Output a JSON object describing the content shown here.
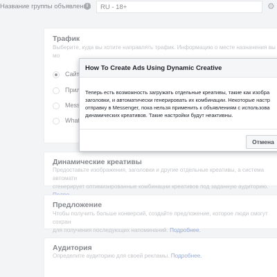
{
  "topbar": {
    "adset_name_label": "Название группы объявлений",
    "adset_name_value": "RU - 18+"
  },
  "traffic": {
    "title": "Трафик",
    "desc": "Выберите, куда вы хотите направлять трафик. Информацию о месте назначения вы мо",
    "options": [
      {
        "label": "Сайт",
        "checked": true
      },
      {
        "label": "Прил",
        "checked": false
      },
      {
        "label": "Messe",
        "checked": false
      },
      {
        "label": "Whats",
        "checked": false
      }
    ]
  },
  "dynamic_creative": {
    "title": "Динамические креативы",
    "desc_line1": "Предоставьте изображения, заголовки и другие отдельные креативы, а система автомати",
    "desc_line2": "сгенерирует оптимизированные комбинации креативов под заданную аудиторию.",
    "link": "Подро"
  },
  "offer": {
    "title": "Предложение",
    "desc_line1": "Чтобы получить больше конверсий, создайте предложение, которое люди смогут сохран",
    "desc_line2": "для получения последующих напоминаний.",
    "link": "Подробнее."
  },
  "audience": {
    "title": "Аудитория",
    "desc": "Определите аудиторию для своей рекламы.",
    "link": "Подробнее."
  },
  "modal": {
    "title": "How To Create Ads Using Dynamic Creative",
    "body_lines": [
      "Теперь есть возможность загружать отдельные креативы, такие как изобра",
      "заголовки, и автоматически генерировать их комбинации. Некоторые настр",
      "отправку в Messenger, пока нельзя применить к объявлениям с использова",
      "динамических креативов. Такие настройки будут неактивны."
    ],
    "cancel_label": "Отмена"
  },
  "icons": {
    "info": "info-icon",
    "gear": "gear-icon"
  }
}
